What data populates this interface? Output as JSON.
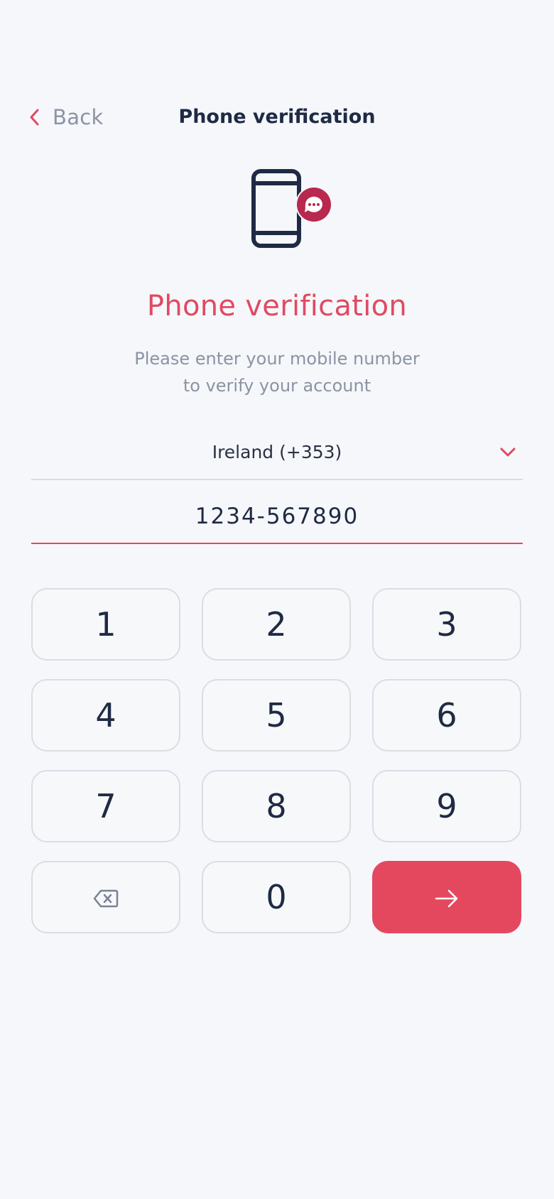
{
  "header": {
    "back_label": "Back",
    "title": "Phone verification"
  },
  "illustration": {
    "icon": "phone-message-icon",
    "phone_color": "#1f2a44",
    "badge_color": "#b8284f"
  },
  "main": {
    "title": "Phone verification",
    "subtitle_line1": "Please enter your mobile number",
    "subtitle_line2": "to verify your account"
  },
  "country_select": {
    "value": "Ireland (+353)",
    "icon": "chevron-down-icon"
  },
  "phone_input": {
    "value": "1234-567890"
  },
  "keypad": {
    "keys": [
      "1",
      "2",
      "3",
      "4",
      "5",
      "6",
      "7",
      "8",
      "9"
    ],
    "zero": "0",
    "backspace_icon": "backspace-icon",
    "submit_icon": "arrow-right-icon"
  },
  "colors": {
    "accent": "#e4485f",
    "background": "#f5f7fa",
    "text": "#1f2a44",
    "muted": "#8b93a3"
  }
}
